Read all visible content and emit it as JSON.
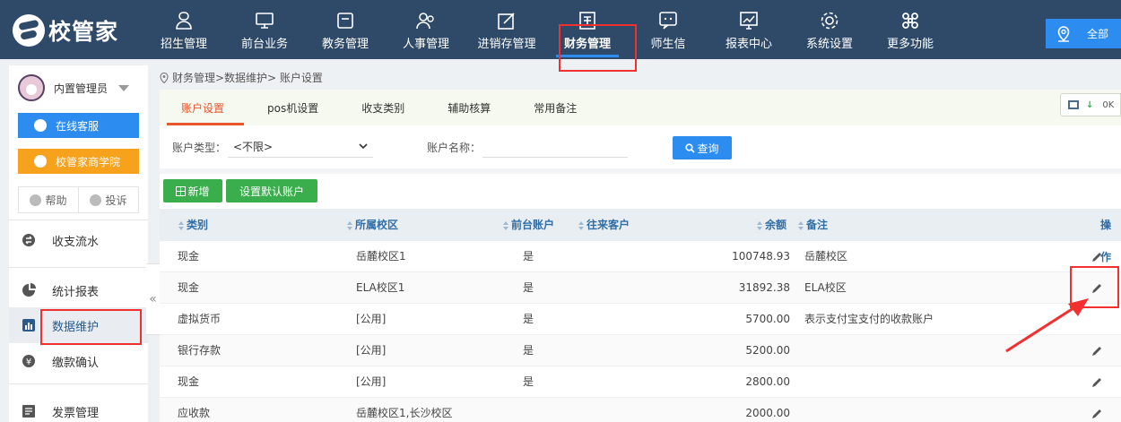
{
  "brand": {
    "name": "校管家"
  },
  "nav": [
    {
      "label": "招生管理",
      "icon": "recruit-icon"
    },
    {
      "label": "前台业务",
      "icon": "monitor-icon"
    },
    {
      "label": "教务管理",
      "icon": "folder-icon"
    },
    {
      "label": "人事管理",
      "icon": "people-icon"
    },
    {
      "label": "进销存管理",
      "icon": "edit-icon"
    },
    {
      "label": "财务管理",
      "icon": "finance-icon"
    },
    {
      "label": "师生信",
      "icon": "chat-icon"
    },
    {
      "label": "报表中心",
      "icon": "chart-icon"
    },
    {
      "label": "系统设置",
      "icon": "gear-icon"
    },
    {
      "label": "更多功能",
      "icon": "command-icon"
    }
  ],
  "nav_active": "财务管理",
  "top_right": {
    "label": "全部"
  },
  "sidebar": {
    "user": "内置管理员",
    "online_service": "在线客服",
    "academy": "校管家商学院",
    "help": "帮助",
    "complaint": "投诉",
    "menu": [
      "收支流水",
      "统计报表",
      "数据维护",
      "缴款确认",
      "发票管理"
    ],
    "active": "数据维护"
  },
  "breadcrumb": "财务管理>数据维护> 账户设置",
  "tabs": [
    "账户设置",
    "pos机设置",
    "收支类别",
    "辅助核算",
    "常用备注"
  ],
  "active_tab": "账户设置",
  "net_widget": {
    "value": "0K"
  },
  "filters": {
    "type_label": "账户类型：",
    "type_value": "<不限>",
    "name_label": "账户名称：",
    "query": "查询"
  },
  "actions": {
    "add": "新增",
    "set_default": "设置默认账户"
  },
  "table": {
    "columns": [
      "类别",
      "所属校区",
      "前台账户",
      "往来客户",
      "余额",
      "备注",
      "操作"
    ],
    "rows": [
      {
        "category": "现金",
        "campus": "岳麓校区1",
        "front": "是",
        "client": "",
        "balance": "100748.93",
        "note": "岳麓校区"
      },
      {
        "category": "现金",
        "campus": "ELA校区1",
        "front": "是",
        "client": "",
        "balance": "31892.38",
        "note": "ELA校区"
      },
      {
        "category": "虚拟货币",
        "campus": "[公用]",
        "front": "是",
        "client": "",
        "balance": "5700.00",
        "note": "表示支付宝支付的收款账户"
      },
      {
        "category": "银行存款",
        "campus": "[公用]",
        "front": "是",
        "client": "",
        "balance": "5200.00",
        "note": ""
      },
      {
        "category": "现金",
        "campus": "[公用]",
        "front": "是",
        "client": "",
        "balance": "2800.00",
        "note": ""
      },
      {
        "category": "应收款",
        "campus": "岳麓校区1,长沙校区",
        "front": "",
        "client": "",
        "balance": "2000.00",
        "note": ""
      }
    ]
  }
}
